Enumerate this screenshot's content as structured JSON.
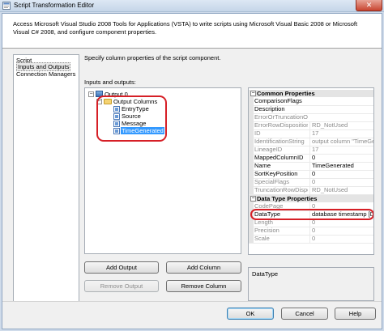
{
  "window": {
    "title": "Script Transformation Editor",
    "close_glyph": "✕"
  },
  "header": {
    "description": "Access Microsoft Visual Studio 2008 Tools for Applications (VSTA) to write scripts using Microsoft Visual Basic 2008 or Microsoft Visual C# 2008, and configure component properties."
  },
  "nav": {
    "items": [
      {
        "label": "Script"
      },
      {
        "label": "Inputs and Outputs"
      },
      {
        "label": "Connection Managers"
      }
    ]
  },
  "main": {
    "instruction": "Specify column properties of the script component.",
    "io_label": "Inputs and outputs:",
    "tree": {
      "output": "Output 0",
      "output_columns": "Output Columns",
      "columns": [
        "EntryType",
        "Source",
        "Message",
        "TimeGenerated"
      ],
      "selected": "TimeGenerated",
      "expanded_glyph": "−"
    },
    "buttons": {
      "add_output": "Add Output",
      "add_column": "Add Column",
      "remove_output": "Remove Output",
      "remove_column": "Remove Column"
    }
  },
  "properties": {
    "common_header": "Common Properties",
    "collapse_glyph": "−",
    "common": [
      {
        "name": "ComparisonFlags",
        "value": "",
        "readonly": false
      },
      {
        "name": "Description",
        "value": "",
        "readonly": false
      },
      {
        "name": "ErrorOrTruncationO",
        "value": "",
        "readonly": true
      },
      {
        "name": "ErrorRowDisposition",
        "value": "RD_NotUsed",
        "readonly": true
      },
      {
        "name": "ID",
        "value": "17",
        "readonly": true
      },
      {
        "name": "IdentificationString",
        "value": "output column \"TimeGe",
        "readonly": true
      },
      {
        "name": "LineageID",
        "value": "17",
        "readonly": true
      },
      {
        "name": "MappedColumnID",
        "value": "0",
        "readonly": false
      },
      {
        "name": "Name",
        "value": "TimeGenerated",
        "readonly": false
      },
      {
        "name": "SortKeyPosition",
        "value": "0",
        "readonly": false
      },
      {
        "name": "SpecialFlags",
        "value": "0",
        "readonly": true
      },
      {
        "name": "TruncationRowDispo",
        "value": "RD_NotUsed",
        "readonly": true
      }
    ],
    "datatype_header": "Data Type Properties",
    "datatype": [
      {
        "name": "CodePage",
        "value": "0",
        "readonly": true
      },
      {
        "name": "DataType",
        "value": "database timestamp [DT_D",
        "readonly": false
      },
      {
        "name": "Length",
        "value": "0",
        "readonly": true
      },
      {
        "name": "Precision",
        "value": "0",
        "readonly": true
      },
      {
        "name": "Scale",
        "value": "0",
        "readonly": true
      }
    ],
    "description_title": "DataType"
  },
  "footer": {
    "ok": "OK",
    "cancel": "Cancel",
    "help": "Help"
  },
  "colors": {
    "highlight_ellipse": "#d61f26",
    "selection": "#3399ff"
  }
}
